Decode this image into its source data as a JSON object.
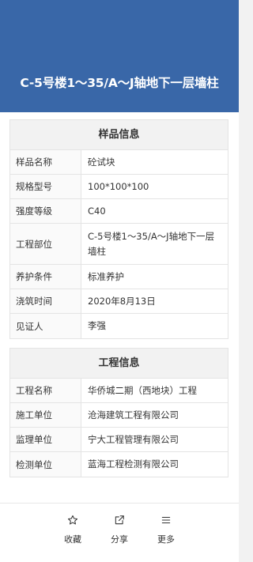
{
  "header": {
    "title": "C-5号楼1～35/A～J轴地下一层墙柱"
  },
  "sample_info": {
    "title": "样品信息",
    "rows": [
      {
        "label": "样品名称",
        "value": "砼试块"
      },
      {
        "label": "规格型号",
        "value": "100*100*100"
      },
      {
        "label": "强度等级",
        "value": "C40"
      },
      {
        "label": "工程部位",
        "value": "C-5号楼1～35/A～J轴地下一层墙柱"
      },
      {
        "label": "养护条件",
        "value": "标准养护"
      },
      {
        "label": "浇筑时间",
        "value": "2020年8月13日"
      },
      {
        "label": "见证人",
        "value": "李强"
      }
    ]
  },
  "project_info": {
    "title": "工程信息",
    "rows": [
      {
        "label": "工程名称",
        "value": "华侨城二期（西地块）工程"
      },
      {
        "label": "施工单位",
        "value": "沧海建筑工程有限公司"
      },
      {
        "label": "监理单位",
        "value": "宁大工程管理有限公司"
      },
      {
        "label": "检测单位",
        "value": "蓝海工程检测有限公司"
      }
    ]
  },
  "footer": {
    "favorite": {
      "label": "收藏",
      "icon": "star-icon"
    },
    "share": {
      "label": "分享",
      "icon": "share-icon"
    },
    "more": {
      "label": "更多",
      "icon": "menu-icon"
    }
  },
  "colors": {
    "header_bg": "#3967a8",
    "card_title_bg": "#f2f2f2",
    "border": "#e4e4e4"
  }
}
